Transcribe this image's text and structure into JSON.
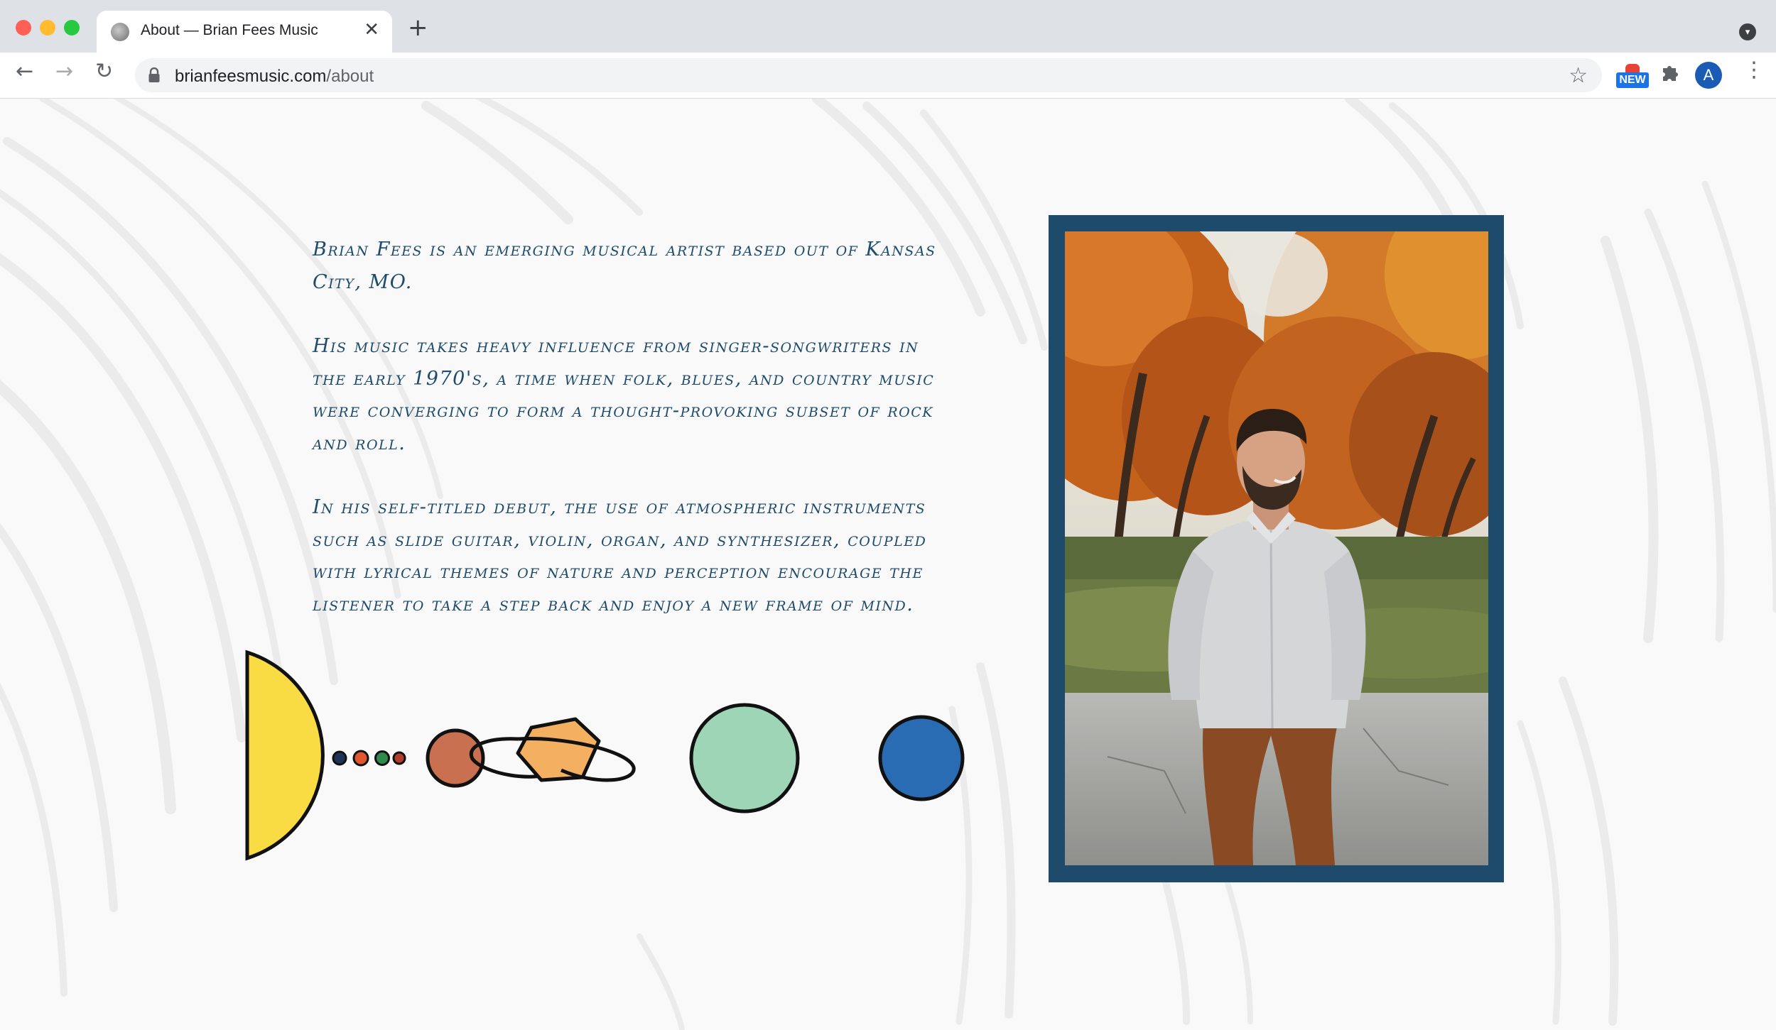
{
  "browser": {
    "tab_title": "About — Brian Fees Music",
    "tab_close": "✕",
    "new_tab": "+",
    "url_host": "brianfeesmusic.com",
    "url_path": "/about",
    "ext_badge": "NEW",
    "avatar_letter": "A",
    "icons": [
      "back-arrow-icon",
      "forward-arrow-icon",
      "reload-icon",
      "lock-icon",
      "bookmark-star-icon",
      "extensions-puzzle-icon",
      "menu-kebab-icon",
      "tab-search-icon"
    ]
  },
  "about": {
    "paragraphs": [
      "Brian Fees is an emerging musical artist based out of Kansas City, MO.",
      "His music takes heavy influence from singer-songwriters in the early 1970's, a time when folk, blues, and country music were converging to form a thought-provoking subset of rock and roll.",
      "In his self-titled debut, the use of atmospheric instruments such as slide guitar, violin, organ, and synthesizer, coupled with lyrical themes of nature and perception encourage the listener to take a step back and enjoy a new frame of mind."
    ]
  },
  "colors": {
    "text_navy": "#1e4b6b",
    "frame_navy": "#1e4b6b",
    "sun_yellow": "#f9dc44",
    "mars_orange": "#c97050",
    "saturn_orange": "#f3b061",
    "uranus_mint": "#9ed5b6",
    "neptune_blue": "#2a6cb3"
  }
}
